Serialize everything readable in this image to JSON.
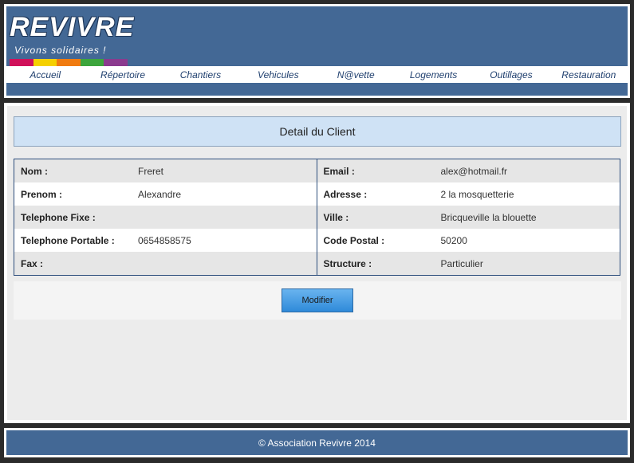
{
  "brand": {
    "title": "REVIVRE",
    "tagline": "Vivons solidaires !",
    "bar_colors": [
      "#d0115a",
      "#f5d000",
      "#f07b10",
      "#3ca53c",
      "#8b3a8e"
    ]
  },
  "nav": {
    "items": [
      "Accueil",
      "Répertoire",
      "Chantiers",
      "Vehicules",
      "N@vette",
      "Logements",
      "Outillages",
      "Restauration"
    ]
  },
  "page": {
    "title": "Detail du Client"
  },
  "client": {
    "left": [
      {
        "label": "Nom :",
        "value": "Freret"
      },
      {
        "label": "Prenom :",
        "value": "Alexandre"
      },
      {
        "label": "Telephone Fixe :",
        "value": ""
      },
      {
        "label": "Telephone Portable :",
        "value": "0654858575"
      },
      {
        "label": "Fax :",
        "value": ""
      }
    ],
    "right": [
      {
        "label": "Email :",
        "value": "alex@hotmail.fr"
      },
      {
        "label": "Adresse :",
        "value": "2 la mosquetterie"
      },
      {
        "label": "Ville :",
        "value": "Bricqueville la blouette"
      },
      {
        "label": "Code Postal :",
        "value": "50200"
      },
      {
        "label": "Structure :",
        "value": "Particulier"
      }
    ]
  },
  "actions": {
    "modify_label": "Modifier"
  },
  "footer": {
    "text": "© Association Revivre 2014"
  },
  "colors": {
    "header_bg": "#436895",
    "title_box_bg": "#cfe2f5"
  }
}
